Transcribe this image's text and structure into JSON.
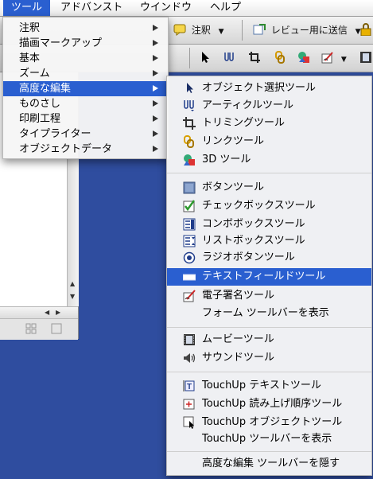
{
  "menubar": {
    "items": [
      {
        "label": "ツール"
      },
      {
        "label": "アドバンスト"
      },
      {
        "label": "ウインドウ"
      },
      {
        "label": "ヘルプ"
      }
    ]
  },
  "toolbar": {
    "comment_label": "注釈",
    "review_label": "レビュー用に送信"
  },
  "tools_menu": {
    "items": [
      {
        "label": "注釈"
      },
      {
        "label": "描画マークアップ"
      },
      {
        "label": "基本"
      },
      {
        "label": "ズーム"
      },
      {
        "label": "高度な編集"
      },
      {
        "label": "ものさし"
      },
      {
        "label": "印刷工程"
      },
      {
        "label": "タイプライター"
      },
      {
        "label": "オブジェクトデータ"
      }
    ],
    "highlighted": "高度な編集"
  },
  "advanced_editing_submenu": {
    "items": [
      {
        "label": "オブジェクト選択ツール",
        "icon": "arrow-select-icon"
      },
      {
        "label": "アーティクルツール",
        "icon": "article-icon"
      },
      {
        "label": "トリミングツール",
        "icon": "crop-icon"
      },
      {
        "label": "リンクツール",
        "icon": "link-icon"
      },
      {
        "label": "3D ツール",
        "icon": "3d-icon"
      },
      {
        "label": "ボタンツール",
        "icon": "button-icon"
      },
      {
        "label": "チェックボックスツール",
        "icon": "checkbox-icon"
      },
      {
        "label": "コンボボックスツール",
        "icon": "combobox-icon"
      },
      {
        "label": "リストボックスツール",
        "icon": "listbox-icon"
      },
      {
        "label": "ラジオボタンツール",
        "icon": "radio-icon"
      },
      {
        "label": "テキストフィールドツール",
        "icon": "textfield-icon"
      },
      {
        "label": "電子署名ツール",
        "icon": "signature-icon"
      },
      {
        "label": "フォーム ツールバーを表示",
        "icon": ""
      },
      {
        "label": "ムービーツール",
        "icon": "movie-icon"
      },
      {
        "label": "サウンドツール",
        "icon": "sound-icon"
      },
      {
        "label": "TouchUp テキストツール",
        "icon": "touchup-text-icon"
      },
      {
        "label": "TouchUp 読み上げ順序ツール",
        "icon": "touchup-reading-order-icon"
      },
      {
        "label": "TouchUp オブジェクトツール",
        "icon": "touchup-object-icon"
      },
      {
        "label": "TouchUp  ツールバーを表示",
        "icon": ""
      },
      {
        "label": "高度な編集 ツールバーを隠す",
        "icon": ""
      }
    ],
    "highlighted": "テキストフィールドツール"
  },
  "colors": {
    "highlight": "#2a5fd0",
    "desktop": "#2f4d9f",
    "menu_bg": "#f6f6f6"
  }
}
